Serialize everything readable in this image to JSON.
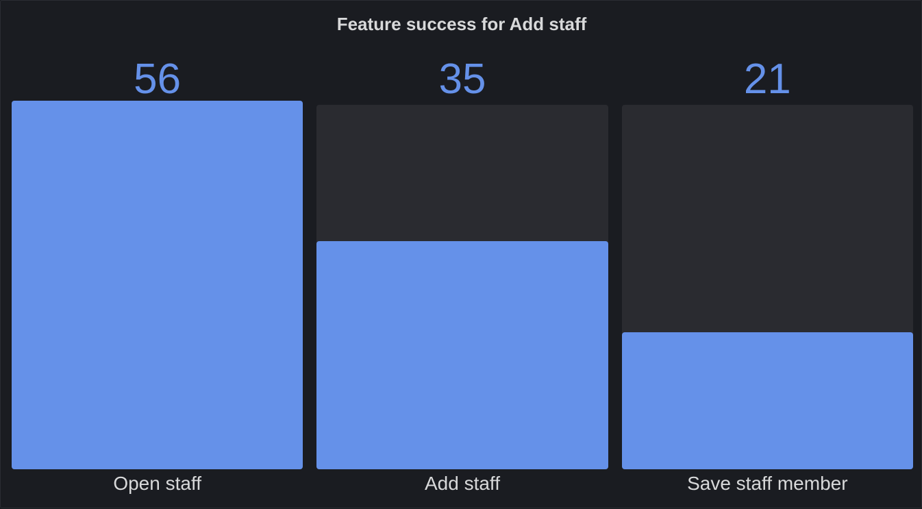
{
  "panel": {
    "title": "Feature success for Add staff"
  },
  "colors": {
    "bar": "#6591e9",
    "value_text": "#6591e9",
    "track": "#2a2b30"
  },
  "chart_data": {
    "type": "bar",
    "title": "Feature success for Add staff",
    "categories": [
      "Open staff",
      "Add staff",
      "Save staff member"
    ],
    "values": [
      56,
      35,
      21
    ],
    "value_labels": [
      "56",
      "35",
      "21"
    ],
    "ylim": [
      0,
      56
    ],
    "grid": false,
    "legend": "none"
  }
}
